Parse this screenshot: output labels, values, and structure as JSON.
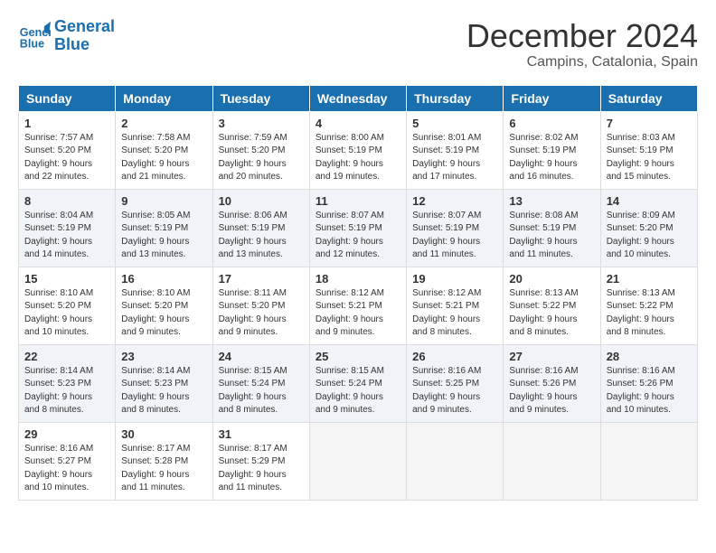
{
  "logo": {
    "line1": "General",
    "line2": "Blue"
  },
  "title": "December 2024",
  "location": "Campins, Catalonia, Spain",
  "weekdays": [
    "Sunday",
    "Monday",
    "Tuesday",
    "Wednesday",
    "Thursday",
    "Friday",
    "Saturday"
  ],
  "weeks": [
    [
      {
        "day": "1",
        "info": "Sunrise: 7:57 AM\nSunset: 5:20 PM\nDaylight: 9 hours\nand 22 minutes."
      },
      {
        "day": "2",
        "info": "Sunrise: 7:58 AM\nSunset: 5:20 PM\nDaylight: 9 hours\nand 21 minutes."
      },
      {
        "day": "3",
        "info": "Sunrise: 7:59 AM\nSunset: 5:20 PM\nDaylight: 9 hours\nand 20 minutes."
      },
      {
        "day": "4",
        "info": "Sunrise: 8:00 AM\nSunset: 5:19 PM\nDaylight: 9 hours\nand 19 minutes."
      },
      {
        "day": "5",
        "info": "Sunrise: 8:01 AM\nSunset: 5:19 PM\nDaylight: 9 hours\nand 17 minutes."
      },
      {
        "day": "6",
        "info": "Sunrise: 8:02 AM\nSunset: 5:19 PM\nDaylight: 9 hours\nand 16 minutes."
      },
      {
        "day": "7",
        "info": "Sunrise: 8:03 AM\nSunset: 5:19 PM\nDaylight: 9 hours\nand 15 minutes."
      }
    ],
    [
      {
        "day": "8",
        "info": "Sunrise: 8:04 AM\nSunset: 5:19 PM\nDaylight: 9 hours\nand 14 minutes."
      },
      {
        "day": "9",
        "info": "Sunrise: 8:05 AM\nSunset: 5:19 PM\nDaylight: 9 hours\nand 13 minutes."
      },
      {
        "day": "10",
        "info": "Sunrise: 8:06 AM\nSunset: 5:19 PM\nDaylight: 9 hours\nand 13 minutes."
      },
      {
        "day": "11",
        "info": "Sunrise: 8:07 AM\nSunset: 5:19 PM\nDaylight: 9 hours\nand 12 minutes."
      },
      {
        "day": "12",
        "info": "Sunrise: 8:07 AM\nSunset: 5:19 PM\nDaylight: 9 hours\nand 11 minutes."
      },
      {
        "day": "13",
        "info": "Sunrise: 8:08 AM\nSunset: 5:19 PM\nDaylight: 9 hours\nand 11 minutes."
      },
      {
        "day": "14",
        "info": "Sunrise: 8:09 AM\nSunset: 5:20 PM\nDaylight: 9 hours\nand 10 minutes."
      }
    ],
    [
      {
        "day": "15",
        "info": "Sunrise: 8:10 AM\nSunset: 5:20 PM\nDaylight: 9 hours\nand 10 minutes."
      },
      {
        "day": "16",
        "info": "Sunrise: 8:10 AM\nSunset: 5:20 PM\nDaylight: 9 hours\nand 9 minutes."
      },
      {
        "day": "17",
        "info": "Sunrise: 8:11 AM\nSunset: 5:20 PM\nDaylight: 9 hours\nand 9 minutes."
      },
      {
        "day": "18",
        "info": "Sunrise: 8:12 AM\nSunset: 5:21 PM\nDaylight: 9 hours\nand 9 minutes."
      },
      {
        "day": "19",
        "info": "Sunrise: 8:12 AM\nSunset: 5:21 PM\nDaylight: 9 hours\nand 8 minutes."
      },
      {
        "day": "20",
        "info": "Sunrise: 8:13 AM\nSunset: 5:22 PM\nDaylight: 9 hours\nand 8 minutes."
      },
      {
        "day": "21",
        "info": "Sunrise: 8:13 AM\nSunset: 5:22 PM\nDaylight: 9 hours\nand 8 minutes."
      }
    ],
    [
      {
        "day": "22",
        "info": "Sunrise: 8:14 AM\nSunset: 5:23 PM\nDaylight: 9 hours\nand 8 minutes."
      },
      {
        "day": "23",
        "info": "Sunrise: 8:14 AM\nSunset: 5:23 PM\nDaylight: 9 hours\nand 8 minutes."
      },
      {
        "day": "24",
        "info": "Sunrise: 8:15 AM\nSunset: 5:24 PM\nDaylight: 9 hours\nand 8 minutes."
      },
      {
        "day": "25",
        "info": "Sunrise: 8:15 AM\nSunset: 5:24 PM\nDaylight: 9 hours\nand 9 minutes."
      },
      {
        "day": "26",
        "info": "Sunrise: 8:16 AM\nSunset: 5:25 PM\nDaylight: 9 hours\nand 9 minutes."
      },
      {
        "day": "27",
        "info": "Sunrise: 8:16 AM\nSunset: 5:26 PM\nDaylight: 9 hours\nand 9 minutes."
      },
      {
        "day": "28",
        "info": "Sunrise: 8:16 AM\nSunset: 5:26 PM\nDaylight: 9 hours\nand 10 minutes."
      }
    ],
    [
      {
        "day": "29",
        "info": "Sunrise: 8:16 AM\nSunset: 5:27 PM\nDaylight: 9 hours\nand 10 minutes."
      },
      {
        "day": "30",
        "info": "Sunrise: 8:17 AM\nSunset: 5:28 PM\nDaylight: 9 hours\nand 11 minutes."
      },
      {
        "day": "31",
        "info": "Sunrise: 8:17 AM\nSunset: 5:29 PM\nDaylight: 9 hours\nand 11 minutes."
      },
      {
        "day": "",
        "info": ""
      },
      {
        "day": "",
        "info": ""
      },
      {
        "day": "",
        "info": ""
      },
      {
        "day": "",
        "info": ""
      }
    ]
  ]
}
